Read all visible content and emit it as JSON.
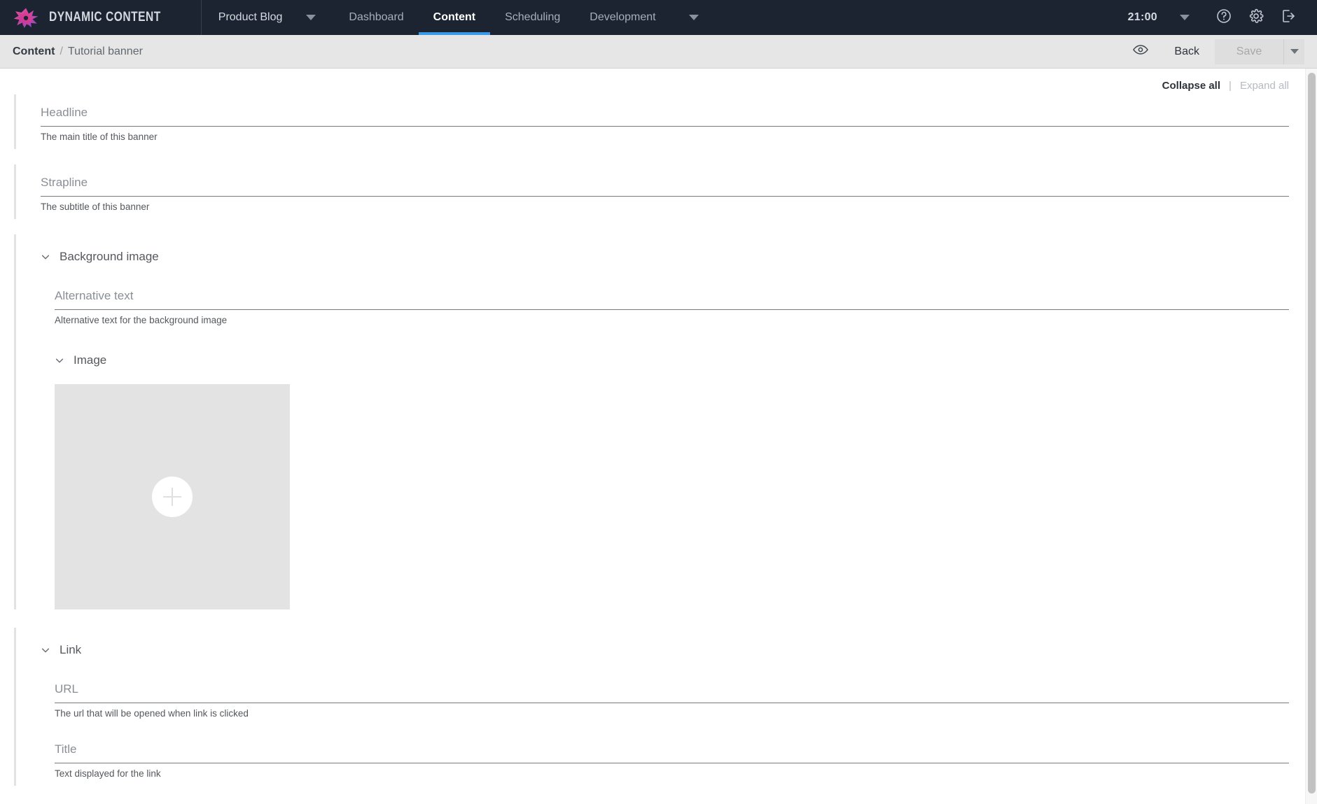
{
  "app": {
    "brand_name": "DYNAMIC CONTENT",
    "logo_icon": "starburst-logo",
    "accent_color": "#3a9ae8",
    "nav_bg": "#1c2431",
    "brand_pink": "#e8408a",
    "brand_purple": "#7b4dd8"
  },
  "topnav": {
    "workspace": "Product Blog",
    "workspace_caret_icon": "chevron-down-icon",
    "tabs": [
      {
        "label": "Dashboard",
        "active": false
      },
      {
        "label": "Content",
        "active": true
      },
      {
        "label": "Scheduling",
        "active": false
      },
      {
        "label": "Development",
        "active": false
      }
    ],
    "overflow_caret_icon": "chevron-down-icon",
    "clock": "21:00",
    "clock_caret_icon": "chevron-down-icon",
    "help_icon": "help-circle-icon",
    "settings_icon": "gear-icon",
    "logout_icon": "logout-icon"
  },
  "subbar": {
    "breadcrumb_root": "Content",
    "breadcrumb_separator": "/",
    "breadcrumb_leaf": "Tutorial banner",
    "preview_icon": "eye-icon",
    "back_label": "Back",
    "save_label": "Save",
    "save_disabled": true,
    "save_caret_icon": "chevron-down-icon"
  },
  "toolbar": {
    "collapse_all_label": "Collapse all",
    "separator": "|",
    "expand_all_label": "Expand all",
    "expand_all_disabled": true
  },
  "form": {
    "fields": [
      {
        "name": "headline",
        "label": "Headline",
        "value": "",
        "help": "The main title of this banner"
      },
      {
        "name": "strapline",
        "label": "Strapline",
        "value": "",
        "help": "The subtitle of this banner"
      }
    ],
    "background_image": {
      "section_label": "Background image",
      "collapse_icon": "chevron-down-icon",
      "alt_text": {
        "label": "Alternative text",
        "value": "",
        "help": "Alternative text for the background image"
      },
      "image": {
        "section_label": "Image",
        "collapse_icon": "chevron-down-icon",
        "add_icon": "plus-icon",
        "placeholder_color": "#e3e3e3"
      }
    },
    "link": {
      "section_label": "Link",
      "collapse_icon": "chevron-down-icon",
      "url": {
        "label": "URL",
        "value": "",
        "help": "The url that will be opened when link is clicked"
      },
      "title": {
        "label": "Title",
        "value": "",
        "help": "Text displayed for the link"
      }
    }
  },
  "scrollbar": {
    "orientation": "vertical",
    "thumb_position": "top"
  }
}
